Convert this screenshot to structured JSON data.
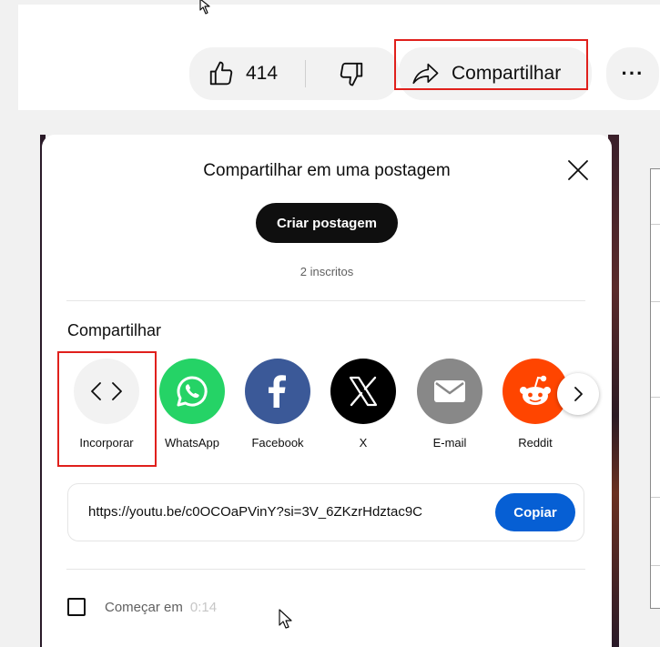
{
  "actions": {
    "like_count": "414",
    "share_label": "Compartilhar"
  },
  "dialog": {
    "title": "Compartilhar em uma postagem",
    "create_post_label": "Criar postagem",
    "subscribers": "2 inscritos",
    "share_section_label": "Compartilhar",
    "targets": [
      {
        "label": "Incorporar",
        "color": "#f2f2f2"
      },
      {
        "label": "WhatsApp",
        "color": "#25d366"
      },
      {
        "label": "Facebook",
        "color": "#3b5998"
      },
      {
        "label": "X",
        "color": "#000000"
      },
      {
        "label": "E-mail",
        "color": "#888888"
      },
      {
        "label": "Reddit",
        "color": "#ff4500"
      }
    ],
    "url": "https://youtu.be/c0OCOaPVinY?si=3V_6ZKzrHdztac9C",
    "copy_label": "Copiar",
    "start_at_label": "Começar em",
    "start_at_time": "0:14"
  },
  "colors": {
    "highlight": "#e0201c",
    "copy_button": "#065fd4"
  }
}
